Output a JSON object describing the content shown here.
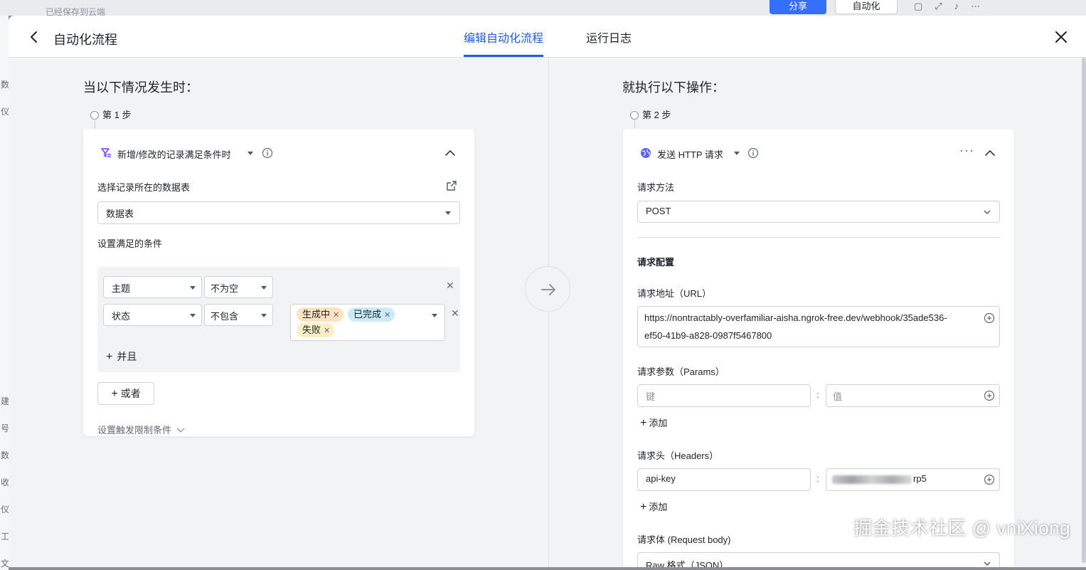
{
  "background": {
    "saved_text": "已经保存到云端",
    "share_label": "分享",
    "automation_label": "自动化",
    "left_strip_chars": [
      "数",
      "仪",
      "建",
      "号",
      "数",
      "收",
      "仪",
      "工",
      "文"
    ]
  },
  "header": {
    "title": "自动化流程",
    "tabs": [
      {
        "label": "编辑自动化流程",
        "active": true
      },
      {
        "label": "运行日志",
        "active": false
      }
    ]
  },
  "trigger": {
    "section_title": "当以下情况发生时：",
    "step_label": "第 1 步",
    "type_label": "新增/修改的记录满足条件时",
    "table_label": "选择记录所在的数据表",
    "table_value": "数据表",
    "conditions_label": "设置满足的条件",
    "conditions": [
      {
        "field": "主题",
        "operator": "不为空",
        "values": []
      },
      {
        "field": "状态",
        "operator": "不包含",
        "values": [
          "生成中",
          "已完成",
          "失败"
        ]
      }
    ],
    "and_label": "并且",
    "or_label": "或者",
    "limit_label": "设置触发限制条件"
  },
  "action": {
    "section_title": "就执行以下操作：",
    "step_label": "第 2 步",
    "type_label": "发送 HTTP 请求",
    "method_label": "请求方法",
    "method_value": "POST",
    "config_title": "请求配置",
    "url_label": "请求地址（URL）",
    "url_value_line1": "https://nontractably-overfamiliar-aisha.ngrok-free.dev/webhook/35ade536-",
    "url_value_line2": "ef50-41b9-a828-0987f5467800",
    "params_label": "请求参数（Params）",
    "params_key_placeholder": "键",
    "params_value_placeholder": "值",
    "add_label": "添加",
    "headers_label": "请求头（Headers）",
    "header_key": "api-key",
    "header_value_visible": "rp5",
    "body_label": "请求体 (Request body)",
    "body_format": "Raw 格式（JSON）"
  },
  "watermark": "掘金技术社区 @ vniXiong",
  "colors": {
    "accent": "#245bdb",
    "tag_orange": "#fde2c2",
    "tag_blue": "#c9ecf6",
    "tag_yellow": "#faefc4"
  }
}
